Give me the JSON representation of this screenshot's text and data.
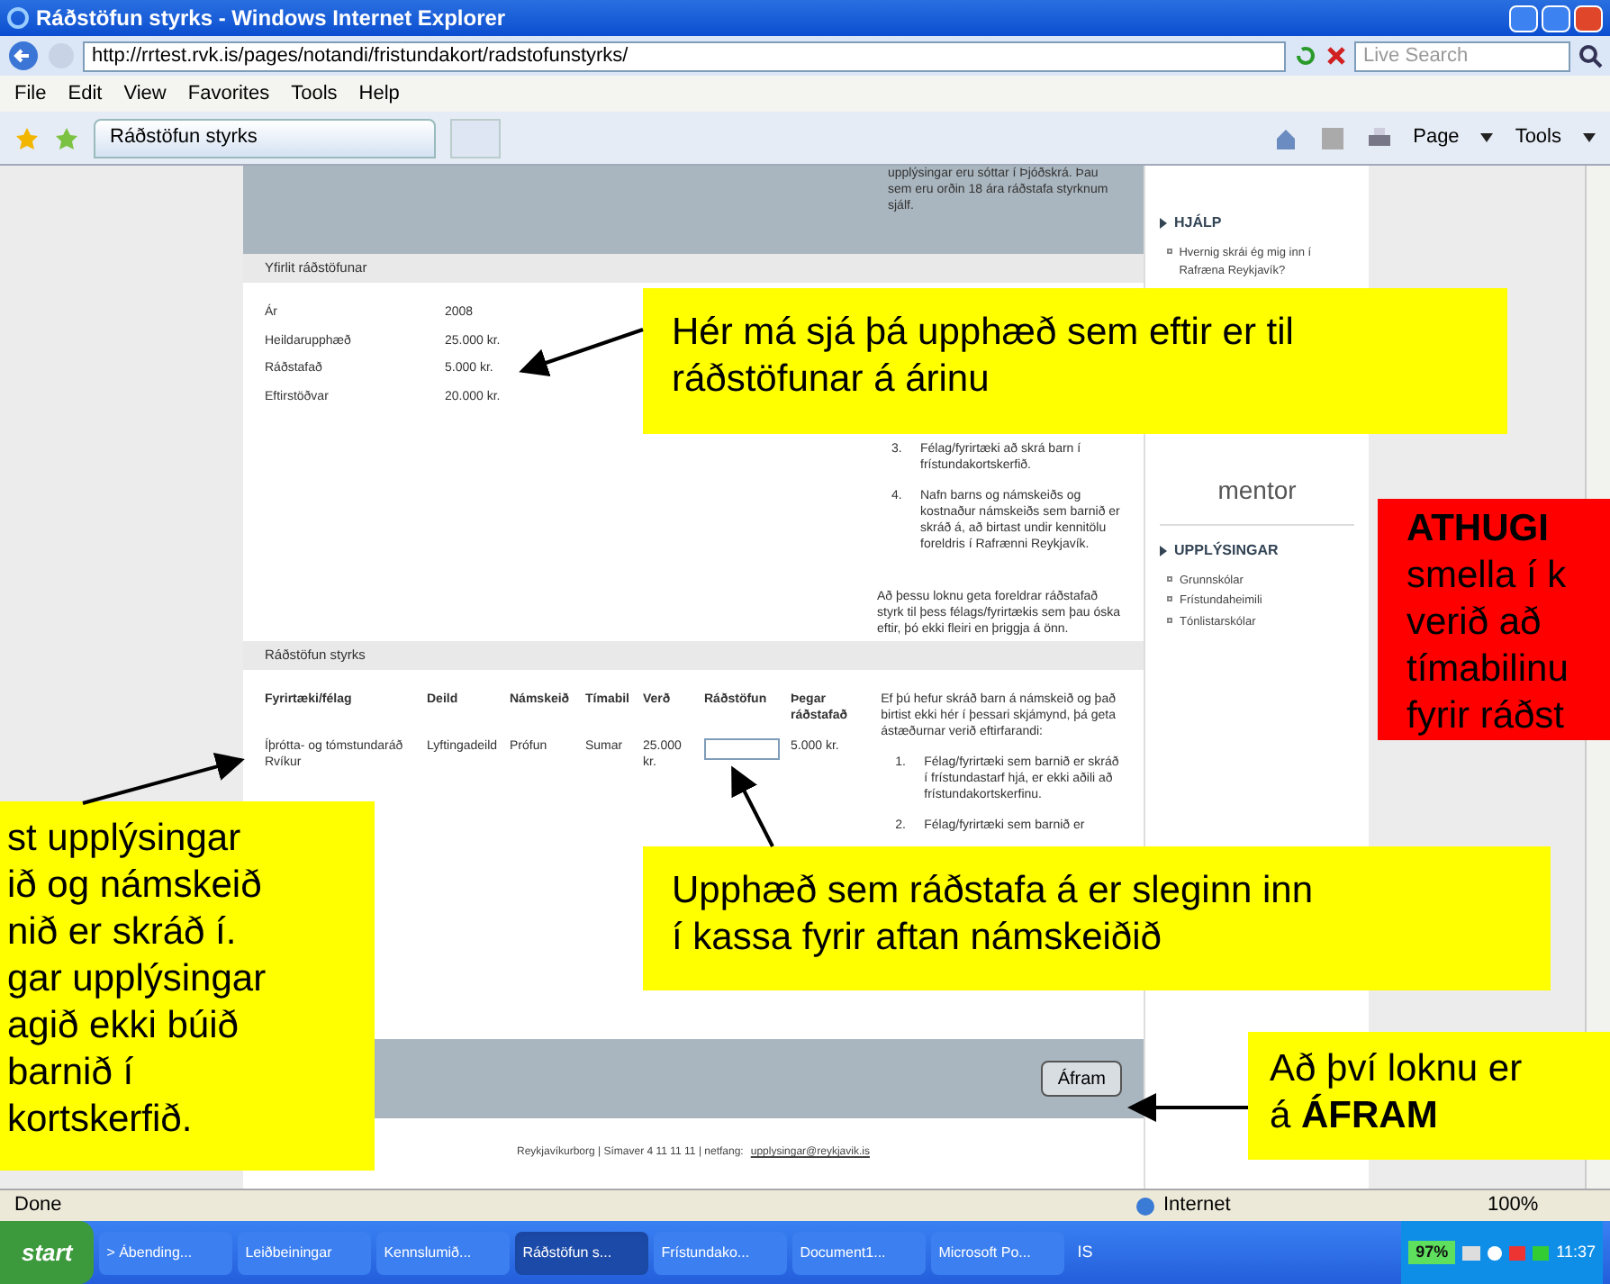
{
  "window": {
    "title": "Ráðstöfun styrks - Windows Internet Explorer"
  },
  "address_bar": {
    "url": "http://rrtest.rvk.is/pages/notandi/fristundakort/radstofunstyrks/",
    "search_placeholder": "Live Search"
  },
  "menu": [
    "File",
    "Edit",
    "View",
    "Favorites",
    "Tools",
    "Help"
  ],
  "tab": {
    "label": "Ráðstöfun styrks"
  },
  "command_bar": [
    "Page",
    "Tools"
  ],
  "page": {
    "top_note": "upplýsingar eru sóttar í Þjóðskrá. Þau sem eru orðin 18 ára ráðstafa styrknum sjálf.",
    "overview": {
      "title": "Yfirlit ráðstöfunar",
      "rows": [
        {
          "label": "Ár",
          "value": "2008"
        },
        {
          "label": "Heildarupphæð",
          "value": "25.000 kr."
        },
        {
          "label": "Ráðstafað",
          "value": "5.000 kr."
        },
        {
          "label": "Eftirstöðvar",
          "value": "20.000 kr."
        }
      ]
    },
    "overview_side": {
      "items": [
        {
          "number": "3.",
          "text": "Félag/fyrirtæki að skrá barn í frístundakortskerfið."
        },
        {
          "number": "4.",
          "text": "Nafn barns og námskeiðs og kostnaður námskeiðs sem barnið er skráð á, að birtast undir kennitölu foreldris í Rafrænni Reykjavík."
        }
      ],
      "paragraph": "Að þessu loknu geta foreldrar ráðstafað styrk til þess félags/fyrirtækis sem þau óska eftir, þó ekki fleiri en þriggja á önn."
    },
    "allocation": {
      "title": "Ráðstöfun styrks",
      "columns": [
        "Fyrirtæki/félag",
        "Deild",
        "Námskeið",
        "Tímabil",
        "Verð",
        "Ráðstöfun",
        "Þegar ráðstafað"
      ],
      "rows": [
        {
          "company": "Íþrótta- og tómstundaráð Rvíkur",
          "department": "Lyftingadeild",
          "course": "Prófun",
          "period": "Sumar",
          "price": "25.000 kr.",
          "allocated": "5.000 kr."
        }
      ]
    },
    "allocation_side": {
      "intro": "Ef þú hefur skráð barn á námskeið og það birtist ekki hér í þessari skjámynd, þá geta ástæðurnar verið eftirfarandi:",
      "items": [
        {
          "number": "1.",
          "text": "Félag/fyrirtæki sem barnið er skráð í frístundastarf hjá, er ekki aðili að frístundakortskerfinu."
        },
        {
          "number": "2.",
          "text": "Félag/fyrirtæki sem barnið er"
        }
      ]
    },
    "button": "Áfram",
    "footer": {
      "text": "Reykjavíkurborg | Símaver 4 11 11 11 | netfang:",
      "email": "upplysingar@reykjavik.is"
    }
  },
  "sidebar": {
    "sections": [
      {
        "title": "HJÁLP",
        "links": [
          "Hvernig skrái ég mig inn í Rafræna Reykjavík?"
        ]
      },
      {
        "title": "UPPLÝSINGAR",
        "links": [
          "Grunnskólar",
          "Frístundaheimili",
          "Tónlistarskólar"
        ]
      }
    ],
    "logo": "mentor"
  },
  "callouts": [
    {
      "kind": "note",
      "lines": [
        "Hér má sjá þá upphæð sem eftir er til",
        "ráðstöfunar á árinu"
      ]
    },
    {
      "kind": "warning",
      "lines": [
        "ATHUGI",
        "smella í k",
        "verið að",
        "tímabilinu",
        "fyrir ráðst"
      ]
    },
    {
      "kind": "note",
      "lines": [
        "st upplýsingar",
        "ið og námskeið",
        "nið er skráð í.",
        "gar upplýsingar",
        "agið ekki búið",
        "barnið í",
        "kortskerfið."
      ]
    },
    {
      "kind": "note",
      "lines": [
        "Upphæð sem ráðstafa á er sleginn inn",
        "í kassa fyrir aftan námskeiðið"
      ]
    },
    {
      "kind": "note",
      "lines": [
        "Að því loknu er",
        "á **ÁFRAM**"
      ]
    }
  ],
  "status_bar": {
    "text": "Done",
    "zone": "Internet",
    "zoom": "100%"
  },
  "taskbar": {
    "start": "start",
    "items": [
      {
        "label": "> Ábending...",
        "selected": false
      },
      {
        "label": "Leiðbeiningar",
        "selected": false
      },
      {
        "label": "Kennslumið...",
        "selected": false
      },
      {
        "label": "Ráðstöfun s...",
        "selected": true
      },
      {
        "label": "Frístundako...",
        "selected": false
      },
      {
        "label": "Document1...",
        "selected": false
      },
      {
        "label": "Microsoft Po...",
        "selected": false
      }
    ],
    "language": "IS",
    "battery": "97%",
    "clock": "11:37"
  }
}
